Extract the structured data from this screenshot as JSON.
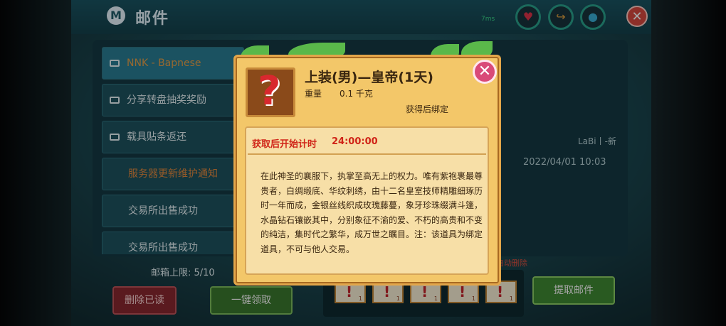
{
  "header": {
    "title": "邮件",
    "mail_icon_glyph": "M",
    "network_label": "7ms",
    "close_glyph": "✕"
  },
  "mail_list": [
    {
      "label": "NNK - Bapnese",
      "state": "active"
    },
    {
      "label": "分享转盘抽奖奖励",
      "state": "read"
    },
    {
      "label": "载具贴条返还",
      "state": "read"
    },
    {
      "label": "服务器更新维护通知",
      "state": "notice"
    },
    {
      "label": "交易所出售成功",
      "state": "normal"
    },
    {
      "label": "交易所出售成功",
      "state": "normal"
    }
  ],
  "detail": {
    "sender": "LaBi丨-新",
    "date": "2022/04/01 10:03",
    "auto_delete_notice": "自动删除"
  },
  "footer": {
    "capacity": "邮箱上限: 5/10",
    "delete_read_label": "删除已读",
    "claim_all_label": "一键领取",
    "get_mail_label": "提取邮件"
  },
  "attachments": [
    {
      "glyph": "!",
      "count": "1"
    },
    {
      "glyph": "!",
      "count": "1"
    },
    {
      "glyph": "!",
      "count": "1"
    },
    {
      "glyph": "!",
      "count": "1"
    },
    {
      "glyph": "!",
      "count": "1"
    }
  ],
  "item_popup": {
    "icon_glyph": "?",
    "title": "上装(男)—皇帝(1天)",
    "weight_label": "重量",
    "weight_value": "0.1 千克",
    "bind_text": "获得后绑定",
    "timer_label": "获取后开始计时",
    "timer_value": "24:00:00",
    "description": "在此神圣的襄服下，执掌至高无上的权力。唯有紫袍裹最尊贵者，白绸缎底、华纹刺绣，由十二名皇室技师精雕细琢历时一年而成，金银丝线织成玫瑰藤蔓，象牙珍珠缀满斗篷，水晶钻石镶嵌其中，分别象征不渝的爱、不朽的高贵和不变的纯洁，集时代之繁华，成万世之瞩目。注：该道具为绑定道具，不可与他人交易。",
    "close_glyph": "✕"
  },
  "colors": {
    "popup_bg": "#f3c769",
    "timer_red": "#d02418",
    "panel_teal": "#1e5360"
  }
}
